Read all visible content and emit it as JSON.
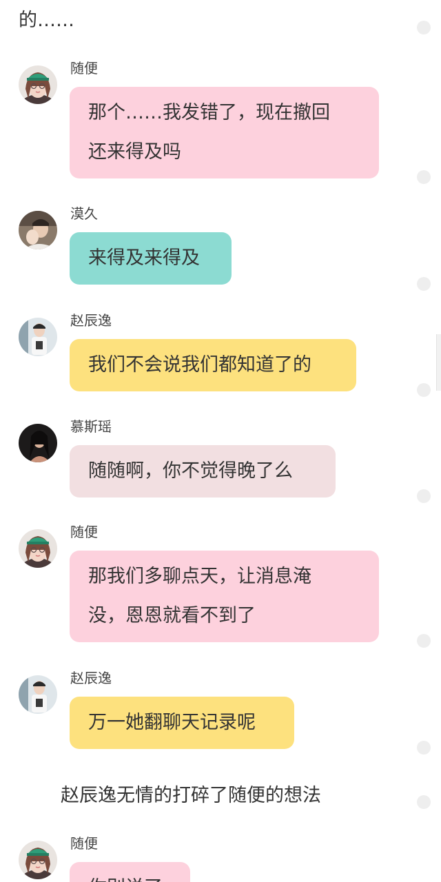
{
  "top_text": "的……",
  "narration": "赵辰逸无情的打碎了随便的想法",
  "colors": {
    "pink_bubble": "#fdd1dd",
    "teal_bubble": "#8cdbd2",
    "yellow_bubble": "#fde17e",
    "rose_bubble": "#f2dfe1"
  },
  "messages": [
    {
      "sender": "随便",
      "text": "那个……我发错了，现在撤回\n还来得及吗",
      "avatar": "girl-green-cap-avatar"
    },
    {
      "sender": "漠久",
      "text": "来得及来得及",
      "avatar": "boy-hand-face-avatar"
    },
    {
      "sender": "赵辰逸",
      "text": "我们不会说我们都知道了的",
      "avatar": "boy-white-shirt-avatar"
    },
    {
      "sender": "慕斯瑶",
      "text": "随随啊，你不觉得晚了么",
      "avatar": "girl-dark-hair-avatar"
    },
    {
      "sender": "随便",
      "text": "那我们多聊点天，让消息淹\n没，恩恩就看不到了",
      "avatar": "girl-green-cap-avatar"
    },
    {
      "sender": "赵辰逸",
      "text": "万一她翻聊天记录呢",
      "avatar": "boy-white-shirt-avatar"
    },
    {
      "sender": "随便",
      "text": "你别说了",
      "avatar": "girl-green-cap-avatar"
    }
  ]
}
